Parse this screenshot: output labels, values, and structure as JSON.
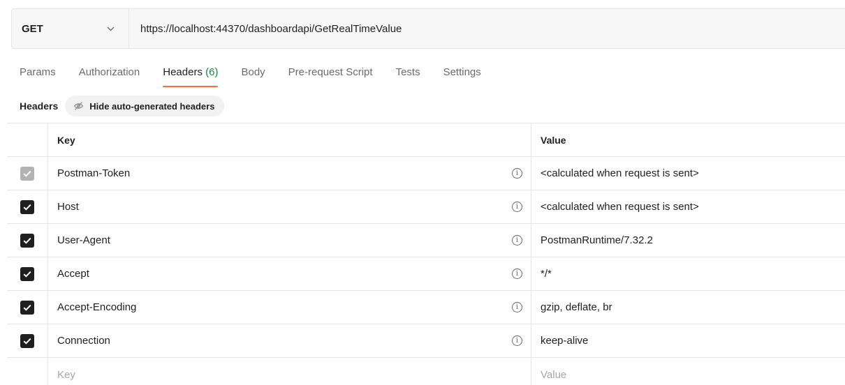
{
  "request": {
    "method": "GET",
    "url": "https://localhost:44370/dashboardapi/GetRealTimeValue"
  },
  "tabs": [
    {
      "label": "Params"
    },
    {
      "label": "Authorization"
    },
    {
      "label": "Headers",
      "count": "(6)",
      "active": true
    },
    {
      "label": "Body"
    },
    {
      "label": "Pre-request Script"
    },
    {
      "label": "Tests"
    },
    {
      "label": "Settings"
    }
  ],
  "headers_section": {
    "title": "Headers",
    "hide_button_label": "Hide auto-generated headers",
    "hide_button_icon": "eye-off-icon"
  },
  "table": {
    "columns": {
      "key": "Key",
      "value": "Value"
    },
    "rows": [
      {
        "key": "Postman-Token",
        "value": "<calculated when request is sent>",
        "checked": true,
        "disabled": true
      },
      {
        "key": "Host",
        "value": "<calculated when request is sent>",
        "checked": true,
        "disabled": false
      },
      {
        "key": "User-Agent",
        "value": "PostmanRuntime/7.32.2",
        "checked": true,
        "disabled": false
      },
      {
        "key": "Accept",
        "value": "*/*",
        "checked": true,
        "disabled": false
      },
      {
        "key": "Accept-Encoding",
        "value": "gzip, deflate, br",
        "checked": true,
        "disabled": false
      },
      {
        "key": "Connection",
        "value": "keep-alive",
        "checked": true,
        "disabled": false
      }
    ],
    "new_row": {
      "key_placeholder": "Key",
      "value_placeholder": "Value"
    }
  },
  "colors": {
    "accent": "#ff6c37",
    "count_green": "#0c8a3d",
    "checkbox": "#1f1f1f",
    "checkbox_disabled": "#b3b3b3"
  }
}
